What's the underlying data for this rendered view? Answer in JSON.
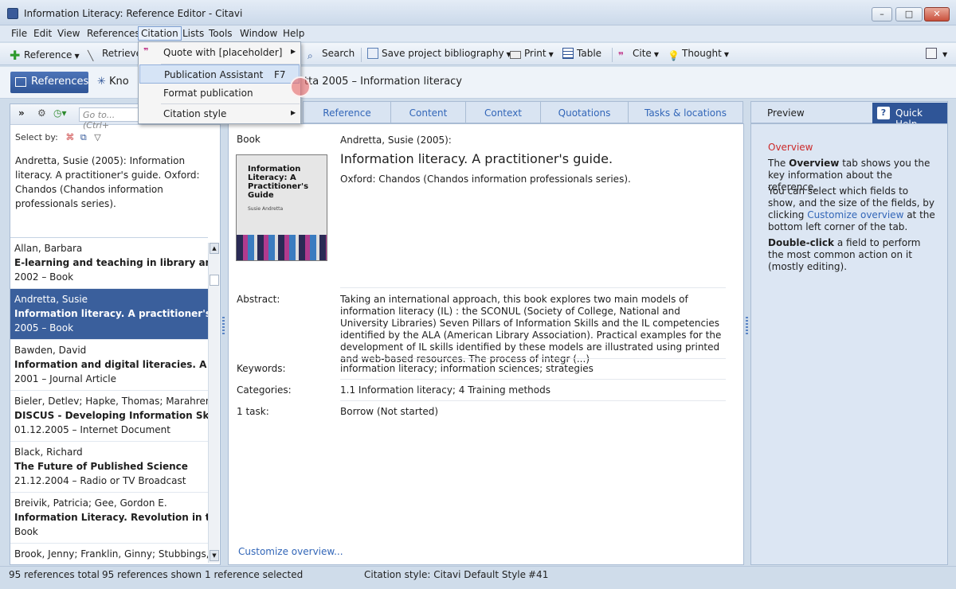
{
  "window": {
    "title": "Information Literacy: Reference Editor - Citavi"
  },
  "menubar": [
    "File",
    "Edit",
    "View",
    "References",
    "Citation",
    "Lists",
    "Tools",
    "Window",
    "Help"
  ],
  "toolbar": {
    "reference": "Reference",
    "retrieve": "Retrieve",
    "search": "Search",
    "save_bib": "Save project bibliography",
    "print": "Print",
    "table": "Table",
    "cite": "Cite",
    "thought": "Thought"
  },
  "nav": {
    "references": "References",
    "knowledge": "Kno",
    "ref_title": "tta 2005 – Information literacy"
  },
  "citation_menu": {
    "items": [
      {
        "label": "Quote with [placeholder]",
        "shortcut": ""
      },
      {
        "label": "Publication Assistant",
        "shortcut": "F7"
      },
      {
        "label": "Format publication",
        "shortcut": ""
      },
      {
        "label": "Citation style",
        "shortcut": ""
      }
    ]
  },
  "left_panel": {
    "goto_placeholder": "Go to... (Ctrl+",
    "select_by": "Select by:",
    "citation_preview": "Andretta, Susie (2005): Information literacy. A practitioner's guide. Oxford: Chandos (Chandos information professionals series).",
    "references": [
      {
        "author": "Allan, Barbara",
        "title": "E-learning and teaching in library and infor",
        "meta": "2002 – Book"
      },
      {
        "author": "Andretta, Susie",
        "title": "Information literacy. A practitioner's guide",
        "meta": "2005 – Book"
      },
      {
        "author": "Bawden, David",
        "title": "Information and digital literacies. A review",
        "meta": "2001 – Journal Article"
      },
      {
        "author": "Bieler, Detlev; Hapke, Thomas; Marahrens,",
        "title": "DISCUS - Developing Information Skills &",
        "meta": "01.12.2005 – Internet Document"
      },
      {
        "author": "Black, Richard",
        "title": "The Future of Published Science",
        "meta": "21.12.2004 – Radio or TV Broadcast"
      },
      {
        "author": "Breivik, Patricia; Gee, Gordon E.",
        "title": "Information Literacy. Revolution in the Libr",
        "meta": "Book"
      },
      {
        "author": "Brook, Jenny; Franklin, Ginny; Stubbings, Ru",
        "title": "",
        "meta": ""
      }
    ]
  },
  "tabs": [
    "Reference",
    "Content",
    "Context",
    "Quotations",
    "Tasks & locations"
  ],
  "overview": {
    "type": "Book",
    "author_year": "Andretta, Susie (2005):",
    "title": "Information literacy. A practitioner's guide.",
    "publisher": "Oxford: Chandos (Chandos information professionals series).",
    "cover_text": "Information Literacy: A Practitioner's Guide",
    "cover_author": "Susie Andretta",
    "abstract_label": "Abstract:",
    "abstract": "Taking an international approach, this book explores two main models of information literacy (IL) : the SCONUL (Society of College, National and University Libraries) Seven Pillars of Information Skills and the IL competencies identified by the ALA (American Library Association). Practical examples for the development of IL skills identified by these models are illustrated using printed and web-based resources. The process of integr (...)",
    "keywords_label": "Keywords:",
    "keywords": "information literacy; information sciences; strategies",
    "categories_label": "Categories:",
    "categories": "1.1 Information literacy; 4 Training methods",
    "task_label": "1 task:",
    "task": "Borrow (Not started)",
    "customize": "Customize overview..."
  },
  "right_panel": {
    "preview": "Preview",
    "quick_help": "Quick Help",
    "heading": "Overview",
    "p1_pre": "The ",
    "p1_bold": "Overview",
    "p1_post": " tab shows you the key information about the reference.",
    "p2_pre": "You can select which fields to show, and the size of the fields, by clicking ",
    "p2_link": "Customize overview",
    "p2_post": " at the bottom left corner of the tab.",
    "p3_bold": "Double-click",
    "p3_post": " a field to perform the most common action on it (mostly editing)."
  },
  "status": {
    "total": "95 references total",
    "shown": "95 references shown",
    "selected": "1 reference selected",
    "style": "Citation style: Citavi Default Style",
    "number": "#41"
  },
  "colors": {
    "accent": "#2f5597",
    "link": "#3266b8",
    "heading": "#cc2a2a"
  }
}
